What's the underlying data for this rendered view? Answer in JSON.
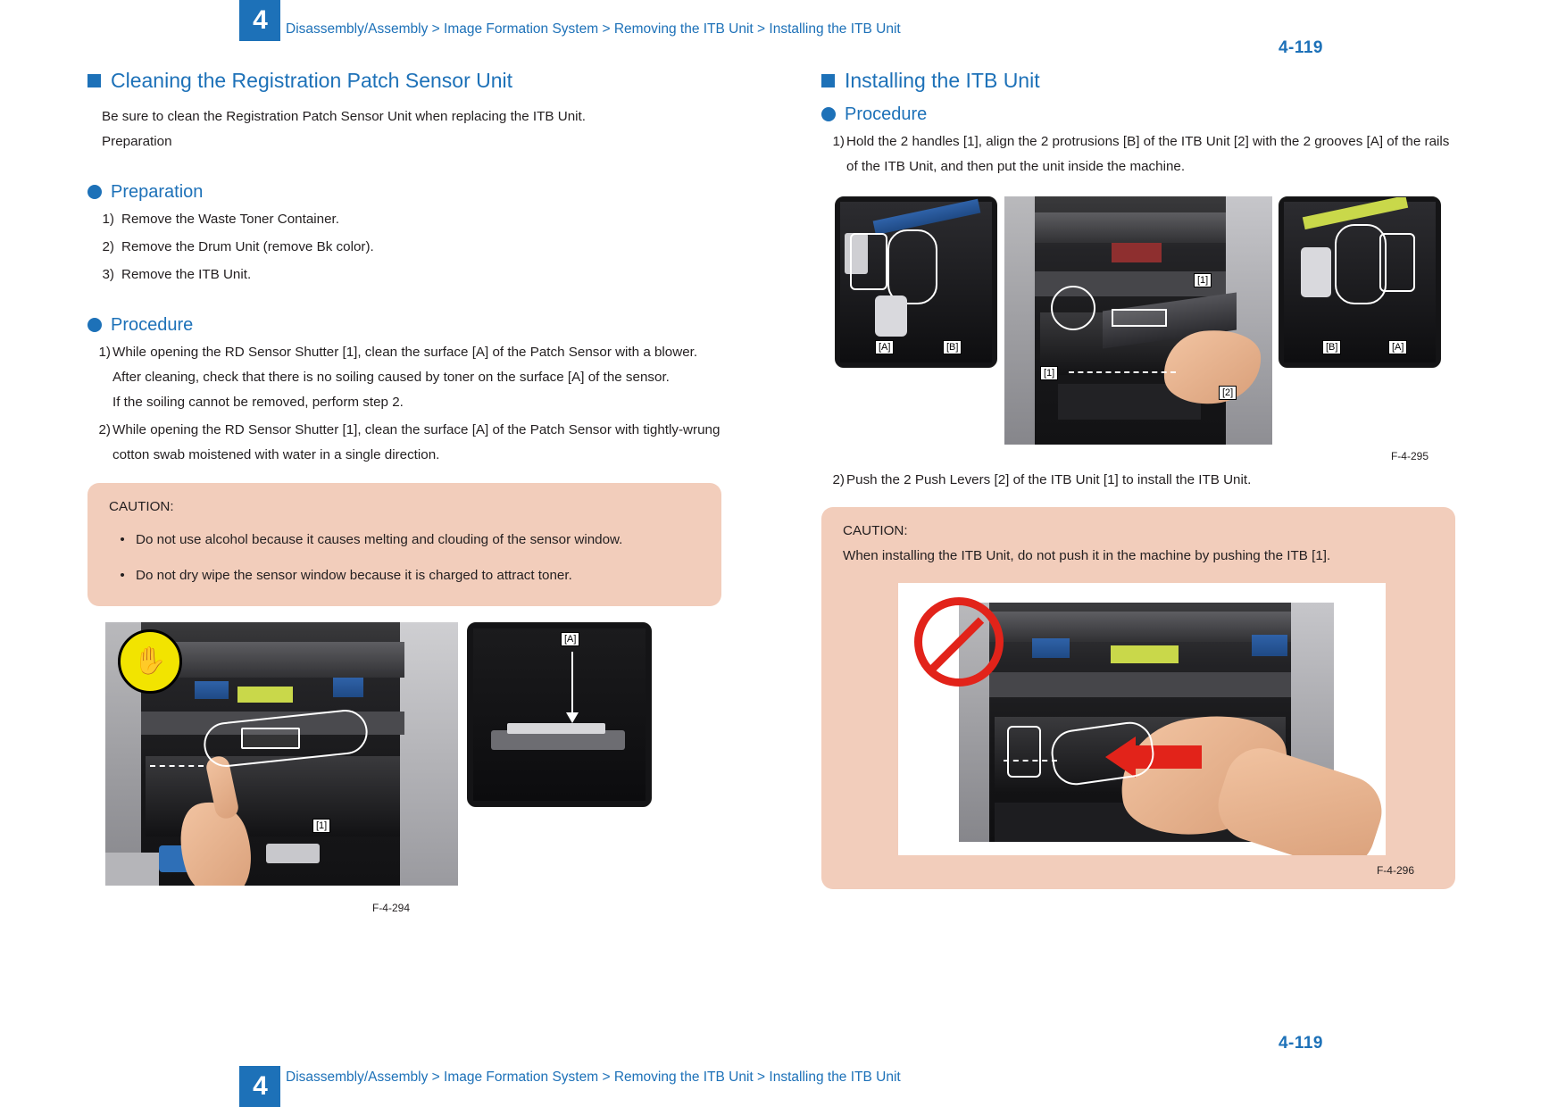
{
  "header": {
    "chapter_number": "4",
    "breadcrumb": "Disassembly/Assembly > Image Formation System > Removing the ITB Unit > Installing the ITB Unit",
    "page_number": "4-119"
  },
  "footer": {
    "chapter_number": "4",
    "breadcrumb": "Disassembly/Assembly > Image Formation System > Removing the ITB Unit > Installing the ITB Unit",
    "page_number": "4-119"
  },
  "left_column": {
    "section_title": "Cleaning the Registration Patch Sensor Unit",
    "intro_line_1": "Be sure to clean the Registration Patch Sensor Unit when replacing the ITB Unit.",
    "intro_line_2": "Preparation",
    "preparation_heading": "Preparation",
    "preparation_steps": [
      {
        "num": "1)",
        "text": "Remove the Waste Toner Container."
      },
      {
        "num": "2)",
        "text": "Remove the Drum Unit (remove Bk color)."
      },
      {
        "num": "3)",
        "text": "Remove the ITB Unit."
      }
    ],
    "procedure_heading": "Procedure",
    "procedure_steps": [
      {
        "num": "1)",
        "text": "While opening the RD Sensor Shutter [1], clean the surface [A] of the Patch Sensor with a blower. After cleaning, check that there is no soiling caused by toner on the surface [A] of the sensor.",
        "extra": "If the soiling cannot be removed, perform step 2."
      },
      {
        "num": "2)",
        "text": "While opening the RD Sensor Shutter [1], clean the surface [A] of the Patch Sensor with tightly-wrung cotton swab moistened with water in a single direction.",
        "extra": ""
      }
    ],
    "caution": {
      "title": "CAUTION:",
      "bullets": [
        "Do not use alcohol because it causes melting and clouding of the sensor window.",
        "Do not dry wipe the sensor window because it is charged to attract toner."
      ]
    },
    "figure": {
      "caption": "F-4-294",
      "callouts": {
        "bracket_a": "[A]",
        "bracket_1": "[1]"
      }
    }
  },
  "right_column": {
    "section_title": "Installing the ITB Unit",
    "procedure_heading": "Procedure",
    "step_1": {
      "num": "1)",
      "text": "Hold the 2 handles [1], align the 2 protrusions [B] of the ITB Unit [2] with the 2 grooves [A] of the rails of the ITB Unit, and then put the unit inside the machine."
    },
    "figure_1": {
      "caption": "F-4-295",
      "callouts": {
        "left_a": "[A]",
        "left_b": "[B]",
        "center_1_upper": "[1]",
        "center_1_lower": "[1]",
        "center_2": "[2]",
        "right_b": "[B]",
        "right_a": "[A]"
      }
    },
    "step_2": {
      "num": "2)",
      "text": "Push the 2 Push Levers [2] of the ITB Unit [1] to install the ITB Unit."
    },
    "caution": {
      "title": "CAUTION:",
      "body": "When installing the ITB Unit, do not push it in the machine by pushing the ITB [1]."
    },
    "figure_2": {
      "caption": "F-4-296"
    }
  },
  "colors": {
    "accent_blue": "#1d71b8",
    "caution_bg": "#f2cdbb",
    "body_text": "#231f20",
    "warning_red": "#e2231a"
  }
}
